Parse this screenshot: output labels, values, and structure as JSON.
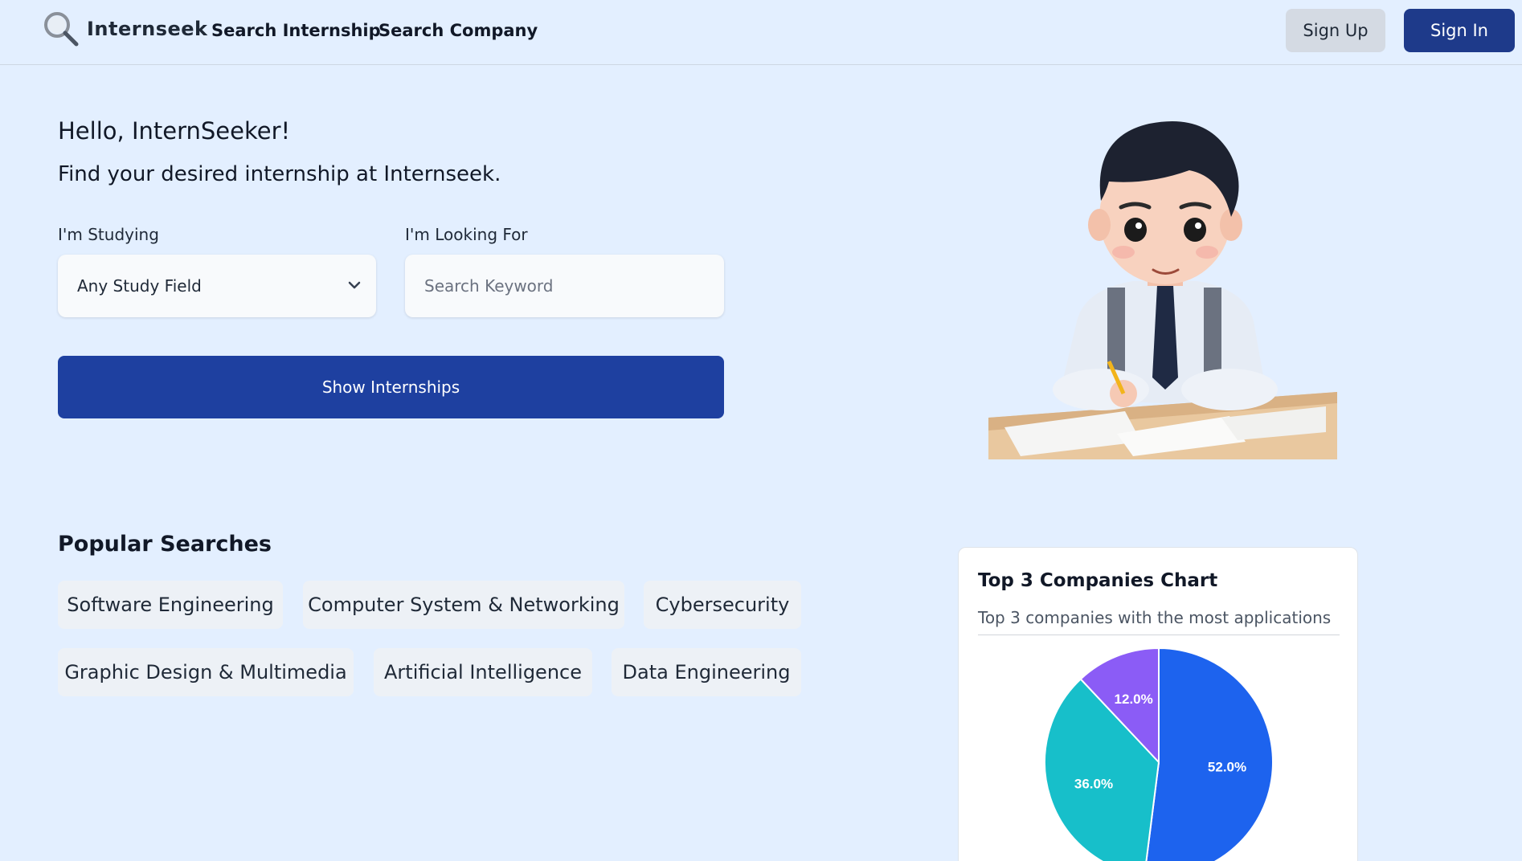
{
  "header": {
    "logo_text": "Internseek",
    "nav": [
      "Search Internship",
      "Search Company"
    ],
    "signup_label": "Sign Up",
    "signin_label": "Sign In"
  },
  "hero": {
    "greeting": "Hello, InternSeeker!",
    "tagline": "Find your desired internship at Internseek.",
    "study_label": "I'm Studying",
    "study_value": "Any Study Field",
    "looking_label": "I'm Looking For",
    "keyword_placeholder": "Search Keyword",
    "show_button": "Show Internships"
  },
  "popular": {
    "title": "Popular Searches",
    "chips": [
      "Software Engineering",
      "Computer System & Networking",
      "Cybersecurity",
      "Graphic Design & Multimedia",
      "Artificial Intelligence",
      "Data Engineering"
    ]
  },
  "chart_card": {
    "title": "Top 3 Companies Chart",
    "subtitle": "Top 3 companies with the most applications"
  },
  "chart_data": {
    "type": "pie",
    "title": "Top 3 Companies Chart",
    "values": [
      52.0,
      36.0,
      12.0
    ],
    "labels": [
      "52.0%",
      "36.0%",
      "12.0%"
    ],
    "colors": [
      "#1d63ee",
      "#17bfca",
      "#8b5cf6"
    ]
  },
  "colors": {
    "background": "#e3efff",
    "primary": "#1e3a8a",
    "button": "#1e40a0"
  }
}
